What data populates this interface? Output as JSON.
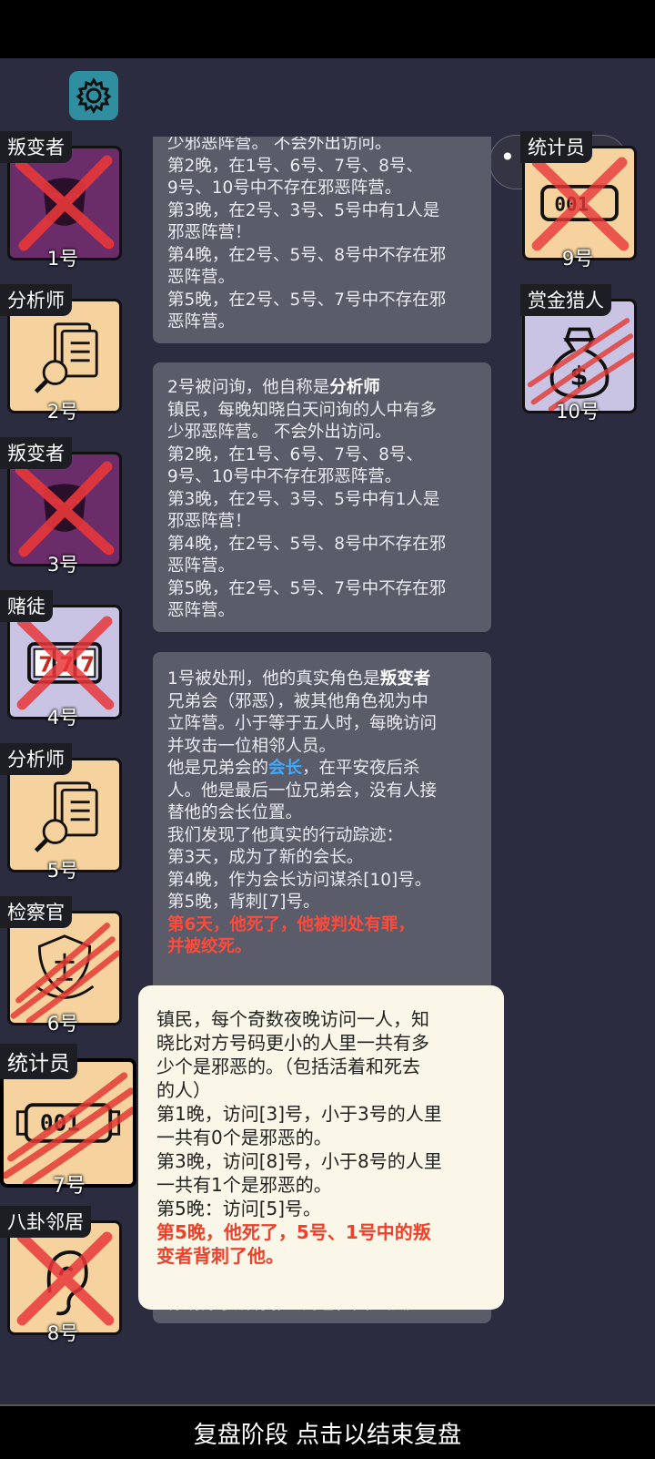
{
  "top_right_capsule": {
    "more_icon": "more-dots-icon",
    "close_icon": "target-close-icon"
  },
  "settings": {
    "icon": "gear-icon"
  },
  "players_left": [
    {
      "role": "叛变者",
      "seat": "1号",
      "bg": "#6b2d6a",
      "crossed": "x"
    },
    {
      "role": "分析师",
      "seat": "2号",
      "bg": "#f6d39e",
      "crossed": "none"
    },
    {
      "role": "叛变者",
      "seat": "3号",
      "bg": "#6b2d6a",
      "crossed": "x"
    },
    {
      "role": "赌徒",
      "seat": "4号",
      "bg": "#c9c4e4",
      "crossed": "x"
    },
    {
      "role": "分析师",
      "seat": "5号",
      "bg": "#f6d39e",
      "crossed": "none"
    },
    {
      "role": "检察官",
      "seat": "6号",
      "bg": "#f6d39e",
      "crossed": "claw"
    },
    {
      "role": "统计员",
      "seat": "7号",
      "bg": "#f6d39e",
      "crossed": "claw"
    },
    {
      "role": "八卦邻居",
      "seat": "8号",
      "bg": "#f6d39e",
      "crossed": "x"
    }
  ],
  "players_right": [
    {
      "role": "统计员",
      "seat": "9号",
      "bg": "#f6d39e",
      "crossed": "x"
    },
    {
      "role": "赏金猎人",
      "seat": "10号",
      "bg": "#c9c4e4",
      "crossed": "claw"
    }
  ],
  "log": {
    "bubble1": [
      "少邪恶阵营。 不会外出访问。",
      "第2晚，在1号、6号、7号、8号、",
      "9号、10号中不存在邪恶阵营。",
      "第3晚，在2号、3号、5号中有1人是",
      "邪恶阵营！",
      "第4晚，在2号、5号、8号中不存在邪",
      "恶阵营。",
      "第5晚，在2号、5号、7号中不存在邪",
      "恶阵营。"
    ],
    "bubble2_prefix": "2号被问询，他自称是",
    "bubble2_role": "分析师",
    "bubble2": [
      "镇民，每晚知晓白天问询的人中有多",
      "少邪恶阵营。 不会外出访问。",
      "第2晚，在1号、6号、7号、8号、",
      "9号、10号中不存在邪恶阵营。",
      "第3晚，在2号、3号、5号中有1人是",
      "邪恶阵营！",
      "第4晚，在2号、5号、8号中不存在邪",
      "恶阵营。",
      "第5晚，在2号、5号、7号中不存在邪",
      "恶阵营。"
    ],
    "bubble3_prefix": "1号被处刑，他的真实角色是",
    "bubble3_role": "叛变者",
    "bubble3_a": [
      "兄弟会（邪恶），被其他角色视为中",
      "立阵营。小于等于五人时，每晚访问",
      "并攻击一位相邻人员。"
    ],
    "bubble3_b_prefix": "他是兄弟会的",
    "bubble3_b_link": "会长",
    "bubble3_b_suffix": "，在平安夜后杀",
    "bubble3_c": [
      "人。他是最后一位兄弟会，没有人接",
      "替他的会长位置。",
      "我们发现了他真实的行动踪迹：",
      "第3天，成为了新的会长。",
      "第4晚，作为会长访问谋杀[10]号。",
      "第5晚，背刺[7]号。"
    ],
    "bubble3_red": [
      "第6天，他死了，他被判处有罪，",
      "并被绞死。"
    ],
    "bubble4": "你清除了所有邪恶角色，因此获胜。"
  },
  "popup": {
    "lines": [
      "镇民，每个奇数夜晚访问一人，知",
      "晓比对方号码更小的人里一共有多",
      "少个是邪恶的。（包括活着和死去",
      "的人）",
      "第1晚，访问[3]号，小于3号的人里",
      "一共有0个是邪恶的。",
      "第3晚，访问[8]号，小于8号的人里",
      "一共有1个是邪恶的。",
      "第5晚：访问[5]号。"
    ],
    "red_lines": [
      "第5晚，他死了，5号、1号中的叛",
      "变者背刺了他。"
    ]
  },
  "bottom_bar": {
    "label": "复盘阶段 点击以结束复盘"
  },
  "colors": {
    "background": "#2b2c40",
    "bubble": "#5a5c6a",
    "red_text": "#ff4a3a",
    "blue_text": "#3fa8ff",
    "popup_bg": "#fbf7e8"
  }
}
